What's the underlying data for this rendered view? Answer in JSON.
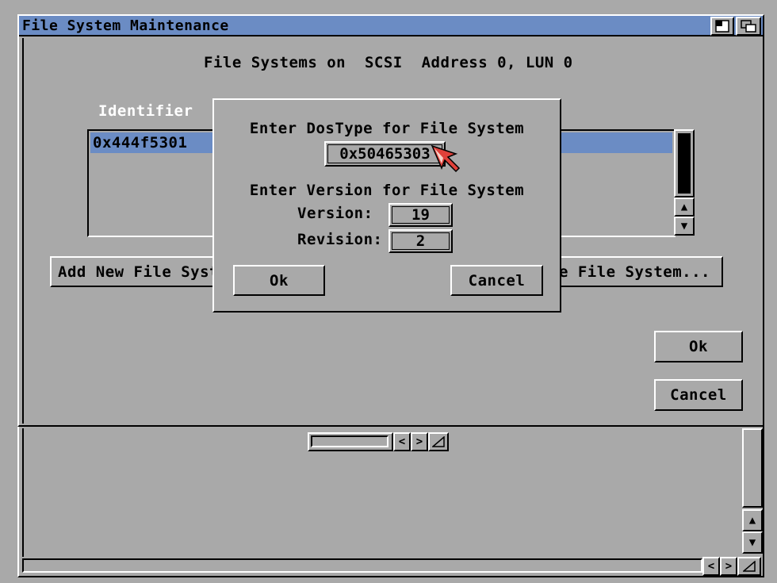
{
  "window": {
    "title": "File System Maintenance",
    "subtitle": "File Systems on  SCSI  Address 0, LUN 0"
  },
  "list": {
    "header": "Identifier",
    "rows": [
      "0x444f5301"
    ]
  },
  "buttons": {
    "add_new": "Add New File System...",
    "update": "Update File System...",
    "ok": "Ok",
    "cancel": "Cancel"
  },
  "dialog": {
    "dostype_prompt": "Enter DosType for File System",
    "dostype_value": "0x50465303",
    "version_prompt": "Enter Version for File System",
    "version_label": "Version:",
    "version_value": "19",
    "revision_label": "Revision:",
    "revision_value": "2",
    "ok": "Ok",
    "cancel": "Cancel"
  },
  "colors": {
    "titlebar": "#6b8cc4",
    "selection": "#6b8cc4",
    "background": "#a9a9a9",
    "pointer": "#e0413a"
  },
  "icons": [
    "depth-icon",
    "zoom-icon",
    "arrow-up-icon",
    "arrow-down-icon",
    "arrow-left-icon",
    "arrow-right-icon",
    "resize-icon",
    "mouse-pointer-icon"
  ]
}
